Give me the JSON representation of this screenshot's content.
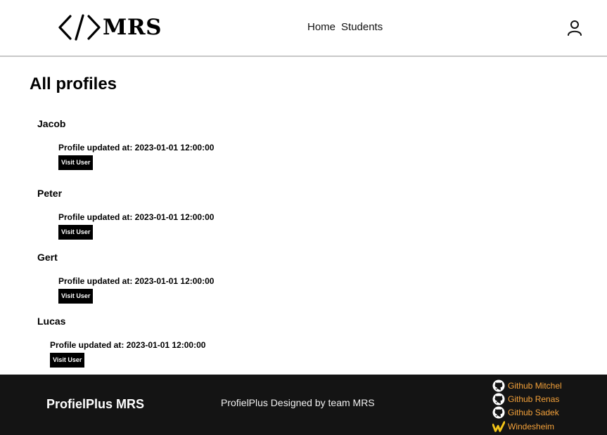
{
  "header": {
    "logo_text": "MRS",
    "nav": [
      {
        "label": "Home"
      },
      {
        "label": "Students"
      }
    ]
  },
  "main": {
    "title": "All profiles",
    "profiles": [
      {
        "name": "Jacob",
        "updated": "Profile updated at: 2023-01-01 12:00:00",
        "button": "Visit User"
      },
      {
        "name": "Peter",
        "updated": "Profile updated at: 2023-01-01 12:00:00",
        "button": "Visit User"
      },
      {
        "name": "Gert",
        "updated": "Profile updated at: 2023-01-01 12:00:00",
        "button": "Visit User"
      },
      {
        "name": "Lucas",
        "updated": "Profile updated at: 2023-01-01 12:00:00",
        "button": "Visit User"
      }
    ]
  },
  "footer": {
    "brand": "ProfielPlus MRS",
    "credit": "ProfielPlus Designed by team MRS",
    "links": [
      {
        "label": "Github Mitchel",
        "icon": "github-icon"
      },
      {
        "label": "Github Renas",
        "icon": "github-icon"
      },
      {
        "label": "Github Sadek",
        "icon": "github-icon"
      },
      {
        "label": "Windesheim",
        "icon": "windesheim-icon"
      }
    ],
    "link_color": "#f5a23a",
    "background": "#141414"
  }
}
